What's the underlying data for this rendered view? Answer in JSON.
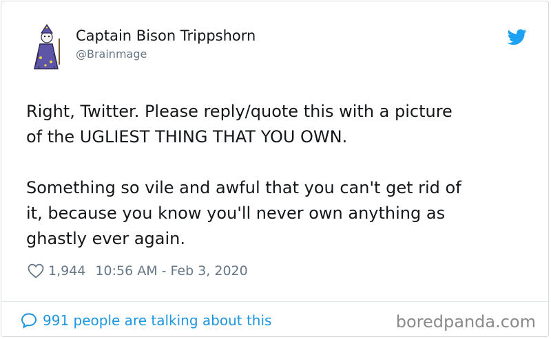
{
  "author": {
    "name": "Captain Bison Trippshorn",
    "handle": "@Brainmage"
  },
  "tweet": {
    "paragraphs": [
      [
        "Right, Twitter. Please reply/quote this with a picture",
        "of the UGLIEST THING THAT YOU OWN."
      ],
      [
        "Something so vile and awful that you can't get rid of",
        "it, because you know you'll never own anything as",
        "ghastly ever again."
      ]
    ]
  },
  "meta": {
    "likes": "1,944",
    "timestamp": "10:56 AM - Feb 3, 2020"
  },
  "footer": {
    "talking": "991 people are talking about this",
    "watermark": "boredpanda.com"
  },
  "icons": {
    "brand": "twitter-bird-icon",
    "like": "heart-icon",
    "conversation": "speech-bubble-icon"
  },
  "colors": {
    "twitter_blue": "#1da1f2",
    "link_blue": "#1b95e0",
    "muted": "#657786",
    "text": "#14171a"
  }
}
